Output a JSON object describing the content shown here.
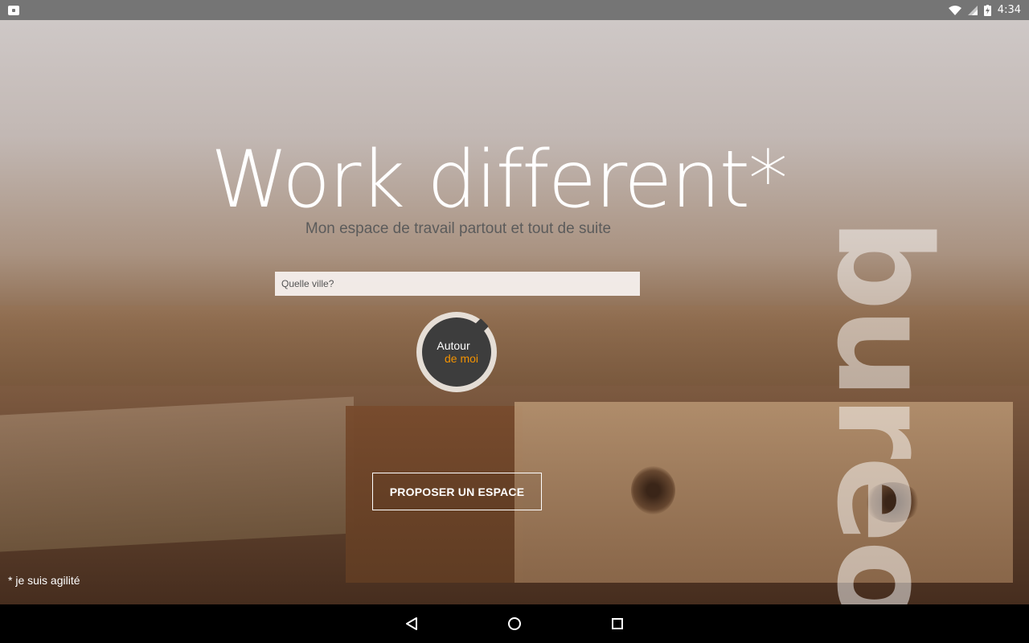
{
  "status_bar": {
    "time": "4:34",
    "left_icon": "shopping-bag-icon",
    "right_icons": [
      "wifi-icon",
      "signal-icon",
      "battery-charging-icon"
    ]
  },
  "hero": {
    "headline": "Work different*",
    "subline": "Mon espace de travail partout et tout de suite"
  },
  "search": {
    "placeholder": "Quelle ville?"
  },
  "around_me": {
    "line1": "Autour",
    "line2": "de moi",
    "accent_color": "#f39200"
  },
  "offer_button": {
    "label": "PROPOSER UN ESPACE"
  },
  "footnote": "* je suis agilité",
  "brand": "bureo",
  "nav": {
    "back": "back-icon",
    "home": "home-icon",
    "recents": "recents-icon"
  }
}
